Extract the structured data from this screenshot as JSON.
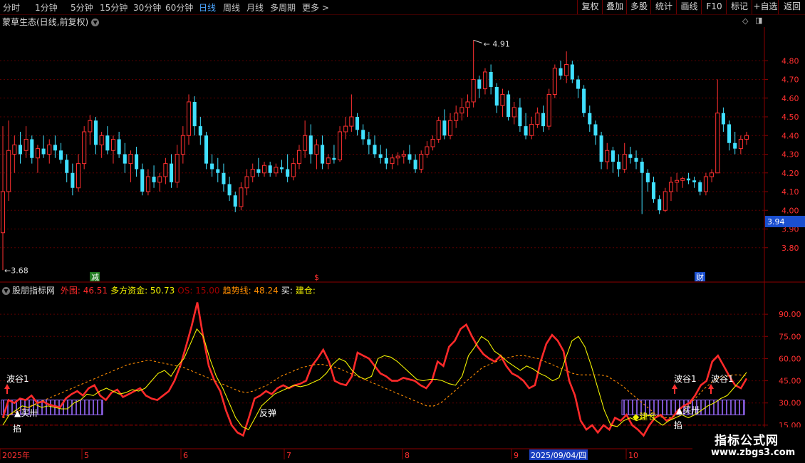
{
  "toolbar": {
    "periods": [
      {
        "label": "分时",
        "active": false
      },
      {
        "label": "1分钟",
        "active": false
      },
      {
        "label": "5分钟",
        "active": false
      },
      {
        "label": "15分钟",
        "active": false
      },
      {
        "label": "30分钟",
        "active": false
      },
      {
        "label": "60分钟",
        "active": false
      },
      {
        "label": "日线",
        "active": true
      },
      {
        "label": "周线",
        "active": false
      },
      {
        "label": "月线",
        "active": false
      },
      {
        "label": "多周期",
        "active": false
      },
      {
        "label": "更多 >",
        "active": false
      }
    ],
    "tools": [
      "复权",
      "叠加",
      "多股",
      "统计",
      "画线",
      "F10",
      "标记",
      "+自选",
      "返回"
    ]
  },
  "stock": {
    "title": "蒙草生态(日线,前复权)",
    "high_label": "4.91",
    "low_label": "3.68",
    "current_price": "3.94",
    "event_markers": [
      "减",
      "$",
      "财"
    ]
  },
  "price_axis": {
    "labels": [
      "4.80",
      "4.70",
      "4.60",
      "4.50",
      "4.40",
      "4.30",
      "4.20",
      "4.10",
      "4.00",
      "3.90",
      "3.80"
    ],
    "min": 3.62,
    "max": 4.98
  },
  "indicator": {
    "name": "股朋指标网",
    "fields": [
      {
        "label": "外围:",
        "value": "46.51",
        "color": "#ff2a2a"
      },
      {
        "label": "多方资金:",
        "value": "50.73",
        "color": "#f0f000"
      },
      {
        "label": "OS:",
        "value": "15.00",
        "color": "#a00000"
      },
      {
        "label": "趋势线:",
        "value": "48.24",
        "color": "#ff8c00"
      },
      {
        "label": "买:",
        "value": "",
        "color": "#ffffff"
      },
      {
        "label": "建仓:",
        "value": "",
        "color": "#f0f000"
      }
    ],
    "axis_labels": [
      "90.00",
      "75.00",
      "60.00",
      "45.00",
      "30.00",
      "15.00"
    ],
    "min": 0,
    "max": 105,
    "signals": {
      "wave_trough": "波谷1",
      "buy_point": "买卅",
      "bottom": "掐",
      "rebound": "反弹",
      "build": "建仓"
    }
  },
  "date_axis": {
    "labels": [
      "2025年",
      "5",
      "6",
      "7",
      "8",
      "9",
      "2025/09/04/四",
      "10"
    ]
  },
  "watermark": {
    "title": "指标公式网",
    "url": "www.zbgs3.com"
  },
  "colors": {
    "up": "#ff3030",
    "down": "#40e0ff",
    "grid": "#5a0000",
    "axis": "#8b0000",
    "current_price_bg": "#1a4fd0"
  },
  "chart_data": {
    "type": "candlestick",
    "x_range": [
      "2025-04-01",
      "2025-10-31"
    ],
    "candles": [
      {
        "o": 3.88,
        "h": 4.45,
        "l": 3.68,
        "c": 4.1
      },
      {
        "o": 4.1,
        "h": 4.48,
        "l": 4.05,
        "c": 4.32
      },
      {
        "o": 4.3,
        "h": 4.4,
        "l": 4.2,
        "c": 4.35
      },
      {
        "o": 4.35,
        "h": 4.42,
        "l": 4.25,
        "c": 4.3
      },
      {
        "o": 4.32,
        "h": 4.45,
        "l": 4.28,
        "c": 4.38
      },
      {
        "o": 4.38,
        "h": 4.4,
        "l": 4.25,
        "c": 4.28
      },
      {
        "o": 4.28,
        "h": 4.35,
        "l": 4.2,
        "c": 4.33
      },
      {
        "o": 4.33,
        "h": 4.4,
        "l": 4.28,
        "c": 4.3
      },
      {
        "o": 4.3,
        "h": 4.38,
        "l": 4.25,
        "c": 4.35
      },
      {
        "o": 4.35,
        "h": 4.4,
        "l": 4.28,
        "c": 4.32
      },
      {
        "o": 4.32,
        "h": 4.36,
        "l": 4.25,
        "c": 4.27
      },
      {
        "o": 4.27,
        "h": 4.3,
        "l": 4.15,
        "c": 4.2
      },
      {
        "o": 4.2,
        "h": 4.25,
        "l": 4.08,
        "c": 4.12
      },
      {
        "o": 4.12,
        "h": 4.3,
        "l": 4.1,
        "c": 4.25
      },
      {
        "o": 4.25,
        "h": 4.45,
        "l": 4.22,
        "c": 4.42
      },
      {
        "o": 4.42,
        "h": 4.51,
        "l": 4.35,
        "c": 4.48
      },
      {
        "o": 4.48,
        "h": 4.5,
        "l": 4.3,
        "c": 4.35
      },
      {
        "o": 4.35,
        "h": 4.42,
        "l": 4.28,
        "c": 4.4
      },
      {
        "o": 4.4,
        "h": 4.45,
        "l": 4.3,
        "c": 4.32
      },
      {
        "o": 4.32,
        "h": 4.4,
        "l": 4.25,
        "c": 4.38
      },
      {
        "o": 4.38,
        "h": 4.42,
        "l": 4.28,
        "c": 4.3
      },
      {
        "o": 4.3,
        "h": 4.36,
        "l": 4.2,
        "c": 4.25
      },
      {
        "o": 4.25,
        "h": 4.32,
        "l": 4.15,
        "c": 4.3
      },
      {
        "o": 4.3,
        "h": 4.34,
        "l": 4.18,
        "c": 4.22
      },
      {
        "o": 4.22,
        "h": 4.25,
        "l": 4.08,
        "c": 4.1
      },
      {
        "o": 4.1,
        "h": 4.22,
        "l": 4.08,
        "c": 4.18
      },
      {
        "o": 4.18,
        "h": 4.24,
        "l": 4.12,
        "c": 4.15
      },
      {
        "o": 4.15,
        "h": 4.2,
        "l": 4.1,
        "c": 4.18
      },
      {
        "o": 4.18,
        "h": 4.28,
        "l": 4.14,
        "c": 4.25
      },
      {
        "o": 4.25,
        "h": 4.3,
        "l": 4.12,
        "c": 4.15
      },
      {
        "o": 4.15,
        "h": 4.35,
        "l": 4.12,
        "c": 4.3
      },
      {
        "o": 4.3,
        "h": 4.45,
        "l": 4.25,
        "c": 4.4
      },
      {
        "o": 4.4,
        "h": 4.62,
        "l": 4.35,
        "c": 4.58
      },
      {
        "o": 4.58,
        "h": 4.61,
        "l": 4.4,
        "c": 4.45
      },
      {
        "o": 4.45,
        "h": 4.5,
        "l": 4.35,
        "c": 4.4
      },
      {
        "o": 4.4,
        "h": 4.42,
        "l": 4.22,
        "c": 4.25
      },
      {
        "o": 4.25,
        "h": 4.3,
        "l": 4.18,
        "c": 4.22
      },
      {
        "o": 4.22,
        "h": 4.28,
        "l": 4.15,
        "c": 4.2
      },
      {
        "o": 4.2,
        "h": 4.25,
        "l": 4.1,
        "c": 4.14
      },
      {
        "o": 4.14,
        "h": 4.18,
        "l": 4.05,
        "c": 4.08
      },
      {
        "o": 4.08,
        "h": 4.1,
        "l": 3.99,
        "c": 4.02
      },
      {
        "o": 4.02,
        "h": 4.15,
        "l": 4.0,
        "c": 4.12
      },
      {
        "o": 4.12,
        "h": 4.22,
        "l": 4.08,
        "c": 4.18
      },
      {
        "o": 4.18,
        "h": 4.25,
        "l": 4.15,
        "c": 4.22
      },
      {
        "o": 4.22,
        "h": 4.28,
        "l": 4.18,
        "c": 4.2
      },
      {
        "o": 4.2,
        "h": 4.26,
        "l": 4.18,
        "c": 4.24
      },
      {
        "o": 4.24,
        "h": 4.26,
        "l": 4.18,
        "c": 4.2
      },
      {
        "o": 4.2,
        "h": 4.25,
        "l": 4.18,
        "c": 4.23
      },
      {
        "o": 4.23,
        "h": 4.27,
        "l": 4.2,
        "c": 4.22
      },
      {
        "o": 4.22,
        "h": 4.3,
        "l": 4.15,
        "c": 4.18
      },
      {
        "o": 4.18,
        "h": 4.28,
        "l": 4.16,
        "c": 4.25
      },
      {
        "o": 4.25,
        "h": 4.35,
        "l": 4.22,
        "c": 4.32
      },
      {
        "o": 4.32,
        "h": 4.48,
        "l": 4.28,
        "c": 4.4
      },
      {
        "o": 4.4,
        "h": 4.46,
        "l": 4.25,
        "c": 4.3
      },
      {
        "o": 4.3,
        "h": 4.38,
        "l": 4.22,
        "c": 4.35
      },
      {
        "o": 4.35,
        "h": 4.4,
        "l": 4.22,
        "c": 4.25
      },
      {
        "o": 4.25,
        "h": 4.3,
        "l": 4.22,
        "c": 4.28
      },
      {
        "o": 4.28,
        "h": 4.35,
        "l": 4.25,
        "c": 4.27
      },
      {
        "o": 4.27,
        "h": 4.45,
        "l": 4.26,
        "c": 4.42
      },
      {
        "o": 4.42,
        "h": 4.5,
        "l": 4.38,
        "c": 4.45
      },
      {
        "o": 4.45,
        "h": 4.62,
        "l": 4.42,
        "c": 4.5
      },
      {
        "o": 4.5,
        "h": 4.52,
        "l": 4.4,
        "c": 4.43
      },
      {
        "o": 4.43,
        "h": 4.46,
        "l": 4.35,
        "c": 4.38
      },
      {
        "o": 4.38,
        "h": 4.42,
        "l": 4.3,
        "c": 4.35
      },
      {
        "o": 4.35,
        "h": 4.4,
        "l": 4.28,
        "c": 4.3
      },
      {
        "o": 4.3,
        "h": 4.35,
        "l": 4.25,
        "c": 4.28
      },
      {
        "o": 4.28,
        "h": 4.33,
        "l": 4.22,
        "c": 4.25
      },
      {
        "o": 4.25,
        "h": 4.3,
        "l": 4.22,
        "c": 4.28
      },
      {
        "o": 4.28,
        "h": 4.31,
        "l": 4.24,
        "c": 4.29
      },
      {
        "o": 4.29,
        "h": 4.32,
        "l": 4.25,
        "c": 4.3
      },
      {
        "o": 4.3,
        "h": 4.35,
        "l": 4.25,
        "c": 4.27
      },
      {
        "o": 4.27,
        "h": 4.3,
        "l": 4.2,
        "c": 4.22
      },
      {
        "o": 4.22,
        "h": 4.32,
        "l": 4.2,
        "c": 4.3
      },
      {
        "o": 4.3,
        "h": 4.37,
        "l": 4.28,
        "c": 4.34
      },
      {
        "o": 4.34,
        "h": 4.4,
        "l": 4.32,
        "c": 4.38
      },
      {
        "o": 4.38,
        "h": 4.5,
        "l": 4.36,
        "c": 4.48
      },
      {
        "o": 4.48,
        "h": 4.54,
        "l": 4.38,
        "c": 4.4
      },
      {
        "o": 4.4,
        "h": 4.52,
        "l": 4.38,
        "c": 4.48
      },
      {
        "o": 4.48,
        "h": 4.56,
        "l": 4.44,
        "c": 4.52
      },
      {
        "o": 4.52,
        "h": 4.6,
        "l": 4.48,
        "c": 4.55
      },
      {
        "o": 4.55,
        "h": 4.62,
        "l": 4.5,
        "c": 4.58
      },
      {
        "o": 4.58,
        "h": 4.91,
        "l": 4.55,
        "c": 4.7
      },
      {
        "o": 4.7,
        "h": 4.72,
        "l": 4.6,
        "c": 4.65
      },
      {
        "o": 4.65,
        "h": 4.76,
        "l": 4.62,
        "c": 4.74
      },
      {
        "o": 4.74,
        "h": 4.78,
        "l": 4.62,
        "c": 4.66
      },
      {
        "o": 4.66,
        "h": 4.68,
        "l": 4.52,
        "c": 4.56
      },
      {
        "o": 4.56,
        "h": 4.65,
        "l": 4.5,
        "c": 4.62
      },
      {
        "o": 4.62,
        "h": 4.64,
        "l": 4.48,
        "c": 4.5
      },
      {
        "o": 4.5,
        "h": 4.58,
        "l": 4.46,
        "c": 4.55
      },
      {
        "o": 4.55,
        "h": 4.6,
        "l": 4.42,
        "c": 4.45
      },
      {
        "o": 4.45,
        "h": 4.52,
        "l": 4.38,
        "c": 4.4
      },
      {
        "o": 4.4,
        "h": 4.5,
        "l": 4.38,
        "c": 4.46
      },
      {
        "o": 4.46,
        "h": 4.55,
        "l": 4.44,
        "c": 4.52
      },
      {
        "o": 4.52,
        "h": 4.56,
        "l": 4.42,
        "c": 4.45
      },
      {
        "o": 4.45,
        "h": 4.65,
        "l": 4.43,
        "c": 4.62
      },
      {
        "o": 4.62,
        "h": 4.78,
        "l": 4.6,
        "c": 4.76
      },
      {
        "o": 4.76,
        "h": 4.8,
        "l": 4.7,
        "c": 4.72
      },
      {
        "o": 4.72,
        "h": 4.85,
        "l": 4.68,
        "c": 4.78
      },
      {
        "o": 4.78,
        "h": 4.8,
        "l": 4.68,
        "c": 4.7
      },
      {
        "o": 4.7,
        "h": 4.72,
        "l": 4.6,
        "c": 4.65
      },
      {
        "o": 4.65,
        "h": 4.67,
        "l": 4.5,
        "c": 4.52
      },
      {
        "o": 4.52,
        "h": 4.56,
        "l": 4.42,
        "c": 4.46
      },
      {
        "o": 4.46,
        "h": 4.48,
        "l": 4.35,
        "c": 4.4
      },
      {
        "o": 4.4,
        "h": 4.42,
        "l": 4.22,
        "c": 4.26
      },
      {
        "o": 4.26,
        "h": 4.36,
        "l": 4.22,
        "c": 4.32
      },
      {
        "o": 4.32,
        "h": 4.34,
        "l": 4.2,
        "c": 4.26
      },
      {
        "o": 4.26,
        "h": 4.3,
        "l": 4.18,
        "c": 4.22
      },
      {
        "o": 4.22,
        "h": 4.36,
        "l": 4.2,
        "c": 4.3
      },
      {
        "o": 4.3,
        "h": 4.34,
        "l": 4.25,
        "c": 4.28
      },
      {
        "o": 4.28,
        "h": 4.32,
        "l": 4.22,
        "c": 4.26
      },
      {
        "o": 4.26,
        "h": 4.28,
        "l": 3.98,
        "c": 4.2
      },
      {
        "o": 4.2,
        "h": 4.22,
        "l": 4.1,
        "c": 4.15
      },
      {
        "o": 4.15,
        "h": 4.18,
        "l": 4.04,
        "c": 4.06
      },
      {
        "o": 4.06,
        "h": 4.08,
        "l": 3.98,
        "c": 4.0
      },
      {
        "o": 4.0,
        "h": 4.12,
        "l": 3.99,
        "c": 4.1
      },
      {
        "o": 4.1,
        "h": 4.18,
        "l": 4.05,
        "c": 4.15
      },
      {
        "o": 4.15,
        "h": 4.2,
        "l": 4.1,
        "c": 4.16
      },
      {
        "o": 4.16,
        "h": 4.18,
        "l": 4.12,
        "c": 4.17
      },
      {
        "o": 4.17,
        "h": 4.2,
        "l": 4.14,
        "c": 4.16
      },
      {
        "o": 4.16,
        "h": 4.18,
        "l": 4.12,
        "c": 4.15
      },
      {
        "o": 4.15,
        "h": 4.16,
        "l": 4.08,
        "c": 4.1
      },
      {
        "o": 4.1,
        "h": 4.2,
        "l": 4.08,
        "c": 4.18
      },
      {
        "o": 4.18,
        "h": 4.22,
        "l": 4.15,
        "c": 4.2
      },
      {
        "o": 4.2,
        "h": 4.7,
        "l": 4.2,
        "c": 4.52
      },
      {
        "o": 4.52,
        "h": 4.55,
        "l": 4.42,
        "c": 4.46
      },
      {
        "o": 4.46,
        "h": 4.48,
        "l": 4.32,
        "c": 4.36
      },
      {
        "o": 4.36,
        "h": 4.42,
        "l": 4.3,
        "c": 4.33
      },
      {
        "o": 4.33,
        "h": 4.4,
        "l": 4.3,
        "c": 4.38
      },
      {
        "o": 4.38,
        "h": 4.42,
        "l": 4.35,
        "c": 4.4
      }
    ],
    "series": [
      {
        "name": "外围",
        "color": "#ff2a2a",
        "values": [
          20,
          32,
          30,
          33,
          32,
          35,
          30,
          31,
          29,
          28,
          27,
          33,
          36,
          38,
          35,
          40,
          42,
          35,
          32,
          37,
          39,
          34,
          36,
          38,
          40,
          35,
          33,
          32,
          35,
          38,
          45,
          55,
          68,
          82,
          98,
          75,
          55,
          45,
          38,
          25,
          15,
          10,
          8,
          20,
          33,
          35,
          38,
          36,
          40,
          42,
          40,
          42,
          43,
          45,
          55,
          60,
          66,
          58,
          45,
          43,
          42,
          48,
          64,
          62,
          60,
          55,
          50,
          48,
          45,
          45,
          47,
          46,
          45,
          42,
          40,
          45,
          58,
          55,
          68,
          72,
          80,
          83,
          75,
          68,
          63,
          60,
          58,
          62,
          55,
          50,
          48,
          45,
          40,
          42,
          58,
          70,
          76,
          72,
          65,
          45,
          35,
          18,
          12,
          15,
          10,
          15,
          12,
          20,
          18,
          22,
          15,
          12,
          8,
          15,
          20,
          22,
          18,
          20,
          25,
          28,
          30,
          35,
          42,
          45,
          58,
          62,
          55,
          48,
          42,
          40,
          46.51
        ]
      },
      {
        "name": "多方资金",
        "color": "#f0f000",
        "values": [
          15,
          22,
          25,
          28,
          27,
          29,
          27,
          28,
          27,
          26,
          26,
          30,
          32,
          36,
          35,
          38,
          40,
          38,
          36,
          37,
          39,
          38,
          40,
          45,
          50,
          52,
          48,
          55,
          60,
          70,
          80,
          75,
          60,
          48,
          40,
          30,
          20,
          14,
          12,
          20,
          28,
          32,
          36,
          38,
          40,
          42,
          41,
          42,
          44,
          46,
          50,
          56,
          60,
          58,
          52,
          48,
          46,
          48,
          60,
          62,
          61,
          58,
          54,
          50,
          46,
          45,
          46,
          46,
          45,
          43,
          42,
          48,
          62,
          68,
          75,
          72,
          65,
          62,
          58,
          55,
          52,
          55,
          53,
          50,
          48,
          45,
          47,
          60,
          72,
          75,
          68,
          55,
          40,
          25,
          15,
          14,
          18,
          20,
          18,
          20,
          22,
          18,
          15,
          18,
          20,
          22,
          20,
          22,
          25,
          28,
          30,
          33,
          35,
          40,
          45,
          50.73
        ]
      },
      {
        "name": "趋势线",
        "color": "#ff8c00",
        "values": [
          20,
          22,
          24,
          26,
          28,
          30,
          32,
          34,
          36,
          38,
          40,
          42,
          44,
          46,
          48,
          50,
          52,
          54,
          56,
          57,
          58,
          59,
          58,
          57,
          56,
          55,
          54,
          52,
          50,
          48,
          46,
          44,
          42,
          40,
          38,
          37,
          38,
          40,
          42,
          45,
          48,
          50,
          52,
          54,
          55,
          56,
          56,
          55,
          54,
          52,
          50,
          48,
          46,
          44,
          42,
          40,
          38,
          36,
          34,
          32,
          30,
          28,
          28,
          30,
          34,
          38,
          42,
          46,
          50,
          54,
          56,
          58,
          60,
          61,
          62,
          62,
          61,
          60,
          58,
          56,
          54,
          52,
          50,
          49,
          49,
          49,
          49,
          48,
          45,
          42,
          38,
          34,
          30,
          26,
          22,
          20,
          20,
          22,
          25,
          30,
          35,
          40,
          44,
          47,
          48,
          49,
          49,
          48.24
        ]
      },
      {
        "name": "OS",
        "color": "#a00000",
        "values": [
          15,
          15,
          15,
          15,
          15,
          15,
          15,
          15,
          15,
          15
        ]
      }
    ]
  }
}
